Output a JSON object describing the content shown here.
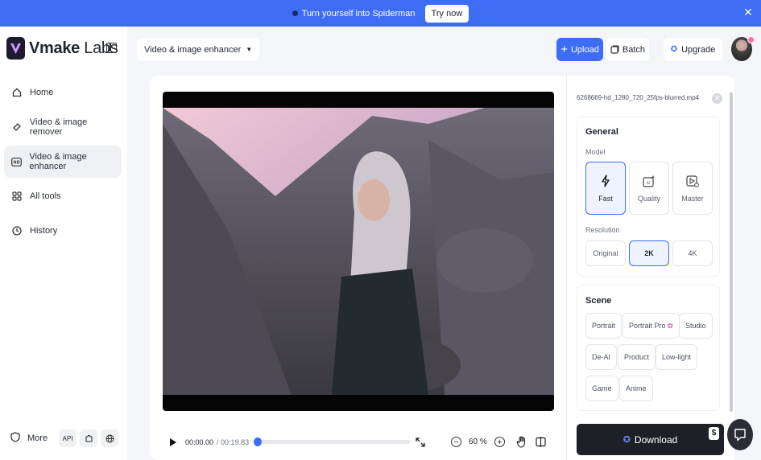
{
  "banner": {
    "text": "Turn yourself into Spiderman",
    "button": "Try now"
  },
  "sidebar": {
    "brand_bold": "Vmake",
    "brand_light": " Labs",
    "items": [
      {
        "label": "Home",
        "icon": "home-icon"
      },
      {
        "label": "Video & image remover",
        "icon": "eraser-icon"
      },
      {
        "label": "Video & image enhancer",
        "icon": "hd-icon"
      },
      {
        "label": "All tools",
        "icon": "grid-icon"
      },
      {
        "label": "History",
        "icon": "clock-icon"
      }
    ],
    "more": "More",
    "api": "API"
  },
  "toolbar": {
    "tool_select": "Video & image enhancer",
    "upload": "Upload",
    "batch": "Batch",
    "upgrade": "Upgrade"
  },
  "player": {
    "current_time": "00:00.00",
    "duration": "/ 00:19.83",
    "progress": 0.0
  },
  "zoom": {
    "value": "60 %"
  },
  "panel": {
    "filename": "6268669-hd_1280_720_25fps-blurred.mp4",
    "general_title": "General",
    "model_label": "Model",
    "models": [
      {
        "label": "Fast",
        "selected": true
      },
      {
        "label": "Quality",
        "selected": false
      },
      {
        "label": "Master",
        "selected": false
      }
    ],
    "resolution_label": "Resolution",
    "resolutions": [
      {
        "label": "Original",
        "selected": false
      },
      {
        "label": "2K",
        "selected": true
      },
      {
        "label": "4K",
        "selected": false
      }
    ],
    "scene_title": "Scene",
    "scenes": [
      "Portrait",
      "Portrait Pro",
      "Studio",
      "De-AI",
      "Product",
      "Low-light",
      "Game",
      "Anime"
    ]
  },
  "download": {
    "label": "Download"
  },
  "colors": {
    "accent": "#3d6df5",
    "dark": "#1e2027"
  }
}
